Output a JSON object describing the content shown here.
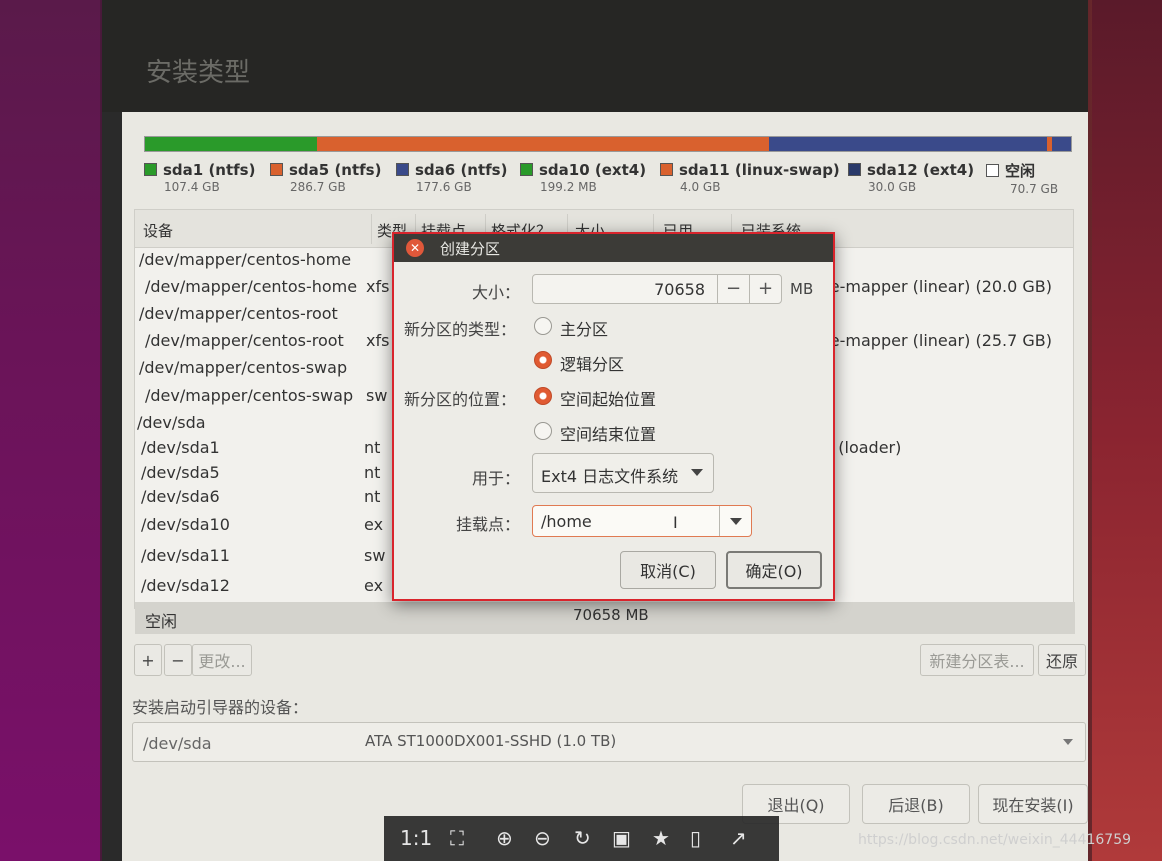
{
  "page_title": "安装类型",
  "partition_bar": [
    {
      "color": "#2a9a2a",
      "size_frac": 0.186
    },
    {
      "color": "#d9612e",
      "size_frac": 0.488
    },
    {
      "color": "#3a4a8a",
      "size_frac": 0.3
    },
    {
      "color": "#d9612e",
      "size_frac": 0.004
    },
    {
      "color": "#3a4a8a",
      "size_frac": 0.02
    }
  ],
  "legend": [
    {
      "name": "sda1 (ntfs)",
      "size": "107.4 GB",
      "color": "#2a9a2a"
    },
    {
      "name": "sda5 (ntfs)",
      "size": "286.7 GB",
      "color": "#d9612e"
    },
    {
      "name": "sda6 (ntfs)",
      "size": "177.6 GB",
      "color": "#3a4a8a"
    },
    {
      "name": "sda10 (ext4)",
      "size": "199.2 MB",
      "color": "#2a9a2a"
    },
    {
      "name": "sda11 (linux-swap)",
      "size": "4.0 GB",
      "color": "#d9612e"
    },
    {
      "name": "sda12 (ext4)",
      "size": "30.0 GB",
      "color": "#2a3a6a"
    },
    {
      "name": "空闲",
      "size": "70.7 GB",
      "color": "#ffffff"
    }
  ],
  "table": {
    "headers": [
      "设备",
      "类型",
      "挂载点",
      "格式化？",
      "大小",
      "已用",
      "已装系统"
    ],
    "rows": [
      {
        "device": "/dev/mapper/centos-home",
        "type": "",
        "extra": ""
      },
      {
        "device": "/dev/mapper/centos-home",
        "type": "xfs",
        "extra": "ce-mapper (linear) (20.0 GB)"
      },
      {
        "device": "/dev/mapper/centos-root",
        "type": "",
        "extra": ""
      },
      {
        "device": "/dev/mapper/centos-root",
        "type": "xfs",
        "extra": "ce-mapper (linear) (25.7 GB)"
      },
      {
        "device": "/dev/mapper/centos-swap",
        "type": "",
        "extra": ""
      },
      {
        "device": "/dev/mapper/centos-swap",
        "type": "sw",
        "extra": ""
      },
      {
        "device": "/dev/sda",
        "type": "",
        "extra": ""
      },
      {
        "device": "/dev/sda1",
        "type": "nt",
        "extra": "0 (loader)"
      },
      {
        "device": "/dev/sda5",
        "type": "nt",
        "extra": ""
      },
      {
        "device": "/dev/sda6",
        "type": "nt",
        "extra": ""
      },
      {
        "device": "/dev/sda10",
        "type": "ex",
        "extra": ""
      },
      {
        "device": "/dev/sda11",
        "type": "sw",
        "extra": ""
      },
      {
        "device": "/dev/sda12",
        "type": "ex",
        "extra": ""
      }
    ],
    "free_row": {
      "device": "空闲",
      "size": "70658 MB"
    }
  },
  "table_buttons": {
    "add": "+",
    "remove": "−",
    "change": "更改...",
    "new_table": "新建分区表...",
    "revert": "还原"
  },
  "boot": {
    "label": "安装启动引导器的设备：",
    "device": "/dev/sda",
    "description": "ATA ST1000DX001-SSHD (1.0 TB)"
  },
  "bottom_buttons": {
    "quit": "退出(Q)",
    "back": "后退(B)",
    "install": "现在安装(I)"
  },
  "dialog": {
    "title": "创建分区",
    "size_label": "大小：",
    "size_value": "70658",
    "minus": "−",
    "plus": "+",
    "size_unit": "MB",
    "type_label": "新分区的类型：",
    "type_primary": "主分区",
    "type_logical": "逻辑分区",
    "location_label": "新分区的位置：",
    "location_start": "空间起始位置",
    "location_end": "空间结束位置",
    "use_label": "用于：",
    "use_value": "Ext4 日志文件系统",
    "mount_label": "挂载点：",
    "mount_value": "/home",
    "cancel": "取消(C)",
    "ok": "确定(O)"
  },
  "viewer_toolbar": {
    "ratio": "1:1"
  },
  "watermark": "https://blog.csdn.net/weixin_44416759"
}
